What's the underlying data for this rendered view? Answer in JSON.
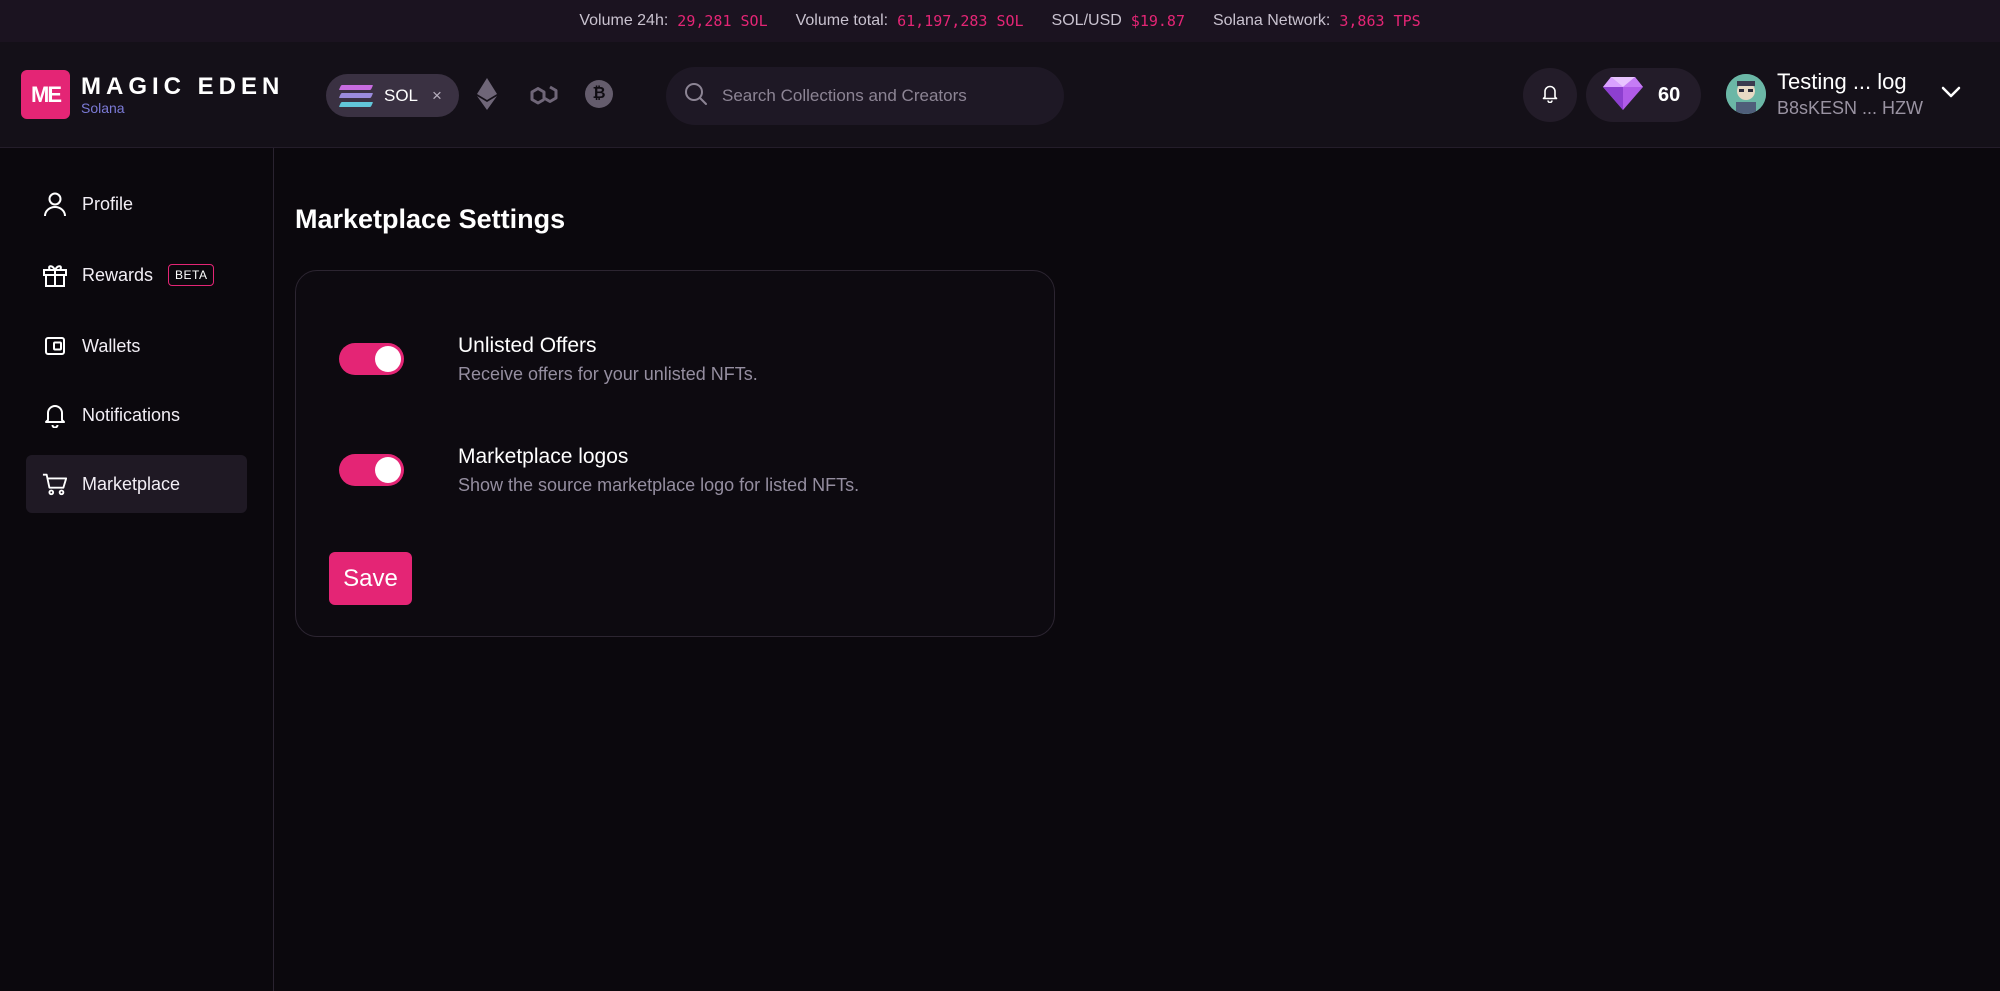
{
  "ticker": [
    {
      "label": "Volume 24h:",
      "value": "29,281 SOL"
    },
    {
      "label": "Volume total:",
      "value": "61,197,283 SOL"
    },
    {
      "label": "SOL/USD",
      "value": "$19.87"
    },
    {
      "label": "Solana Network:",
      "value": "3,863 TPS"
    }
  ],
  "header": {
    "logo_mark": "ME",
    "logo_name": "MAGIC EDEN",
    "logo_chain": "Solana",
    "chain_selected": "SOL",
    "chain_close": "×",
    "other_chains": [
      "ethereum-icon",
      "polygon-icon",
      "bitcoin-icon"
    ],
    "btc_glyph": "₿",
    "search_placeholder": "Search Collections and Creators",
    "diamond_count": "60",
    "user_name": "Testing ... log",
    "user_address": "B8sKESN ... HZW"
  },
  "sidebar": {
    "items": [
      {
        "label": "Profile",
        "icon": "user-icon"
      },
      {
        "label": "Rewards",
        "icon": "gift-icon",
        "badge": "BETA"
      },
      {
        "label": "Wallets",
        "icon": "wallet-icon"
      },
      {
        "label": "Notifications",
        "icon": "bell-icon"
      },
      {
        "label": "Marketplace",
        "icon": "cart-icon",
        "active": true
      }
    ]
  },
  "main": {
    "title": "Marketplace Settings",
    "settings": [
      {
        "title": "Unlisted Offers",
        "description": "Receive offers for your unlisted NFTs.",
        "enabled": true
      },
      {
        "title": "Marketplace logos",
        "description": "Show the source marketplace logo for listed NFTs.",
        "enabled": true
      }
    ],
    "save_label": "Save"
  },
  "colors": {
    "accent": "#e42575",
    "background": "#0b080d",
    "header_bg": "#141018",
    "ticker_bg": "#1b1320"
  }
}
